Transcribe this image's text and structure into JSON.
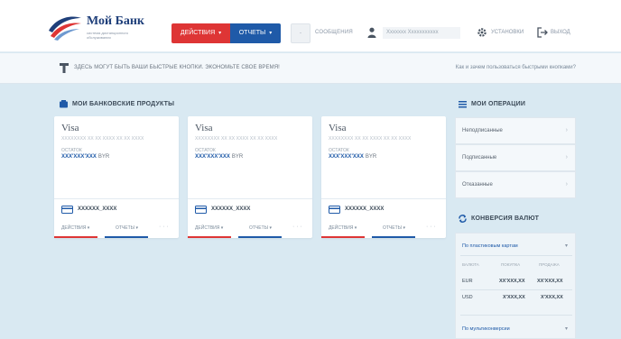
{
  "header": {
    "logo_title": "Мой Банк",
    "logo_subtitle": "система дистанционного обслуживания",
    "actions_label": "ДЕЙСТВИЯ",
    "reports_label": "ОТЧЕТЫ",
    "messages_count": "-",
    "messages_label": "СООБЩЕНИЯ",
    "user_name": "Xxxxxxx Xxxxxxxxxxx",
    "settings_label": "УСТАНОВКИ",
    "exit_label": "ВЫХОД"
  },
  "quickbar": {
    "text": "ЗДЕСЬ МОГУТ БЫТЬ ВАШИ БЫСТРЫЕ КНОПКИ. ЭКОНОМЬТЕ СВОЕ ВРЕМЯ!",
    "help_link": "Как и зачем пользоваться быстрыми кнопками?"
  },
  "products": {
    "title": "МОИ БАНКОВСКИЕ ПРОДУКТЫ",
    "cards": [
      {
        "name": "Visa",
        "number": "XXXXXXXX XX XX XXXX XX XX XXXX",
        "balance_label": "ОСТАТОК",
        "balance": "XXX'XXX'XXX",
        "currency": "BYR",
        "account": "XXXXXX_XXXX",
        "actions": "ДЕЙСТВИЯ",
        "reports": "ОТЧЕТЫ",
        "more": "· · ·"
      },
      {
        "name": "Visa",
        "number": "XXXXXXXX XX XX XXXX XX XX XXXX",
        "balance_label": "ОСТАТОК",
        "balance": "XXX'XXX'XXX",
        "currency": "BYR",
        "account": "XXXXXX_XXXX",
        "actions": "ДЕЙСТВИЯ",
        "reports": "ОТЧЕТЫ",
        "more": "· · ·"
      },
      {
        "name": "Visa",
        "number": "XXXXXXXX XX XX XXXX XX XX XXXX",
        "balance_label": "ОСТАТОК",
        "balance": "XXX'XXX'XXX",
        "currency": "BYR",
        "account": "XXXXXX_XXXX",
        "actions": "ДЕЙСТВИЯ",
        "reports": "ОТЧЕТЫ",
        "more": "· · ·"
      }
    ]
  },
  "operations": {
    "title": "МОИ ОПЕРАЦИИ",
    "items": [
      "Неподписанные",
      "Подписанные",
      "Отказанные"
    ]
  },
  "conversion": {
    "title": "КОНВЕРСИЯ ВАЛЮТ",
    "card_rates_label": "По пластиковым картам",
    "col_currency": "ВАЛЮТА",
    "col_buy": "ПОКУПКА",
    "col_sell": "ПРОДАЖА",
    "rows": [
      {
        "currency": "EUR",
        "buy": "XX'XXX,XX",
        "sell": "XX'XXX,XX"
      },
      {
        "currency": "USD",
        "buy": "X'XXX,XX",
        "sell": "X'XXX,XX"
      }
    ],
    "multi_label": "По мультиконверсии"
  },
  "colors": {
    "accent_red": "#de3535",
    "accent_blue": "#1f5aa8",
    "background": "#d9e9f2"
  },
  "icons": [
    "logo-swoosh-icon",
    "user-icon",
    "gear-icon",
    "exit-icon",
    "quick-buttons-icon",
    "wallet-icon",
    "list-icon",
    "conversion-icon",
    "card-icon",
    "chevron-down-icon",
    "chevron-right-icon"
  ]
}
